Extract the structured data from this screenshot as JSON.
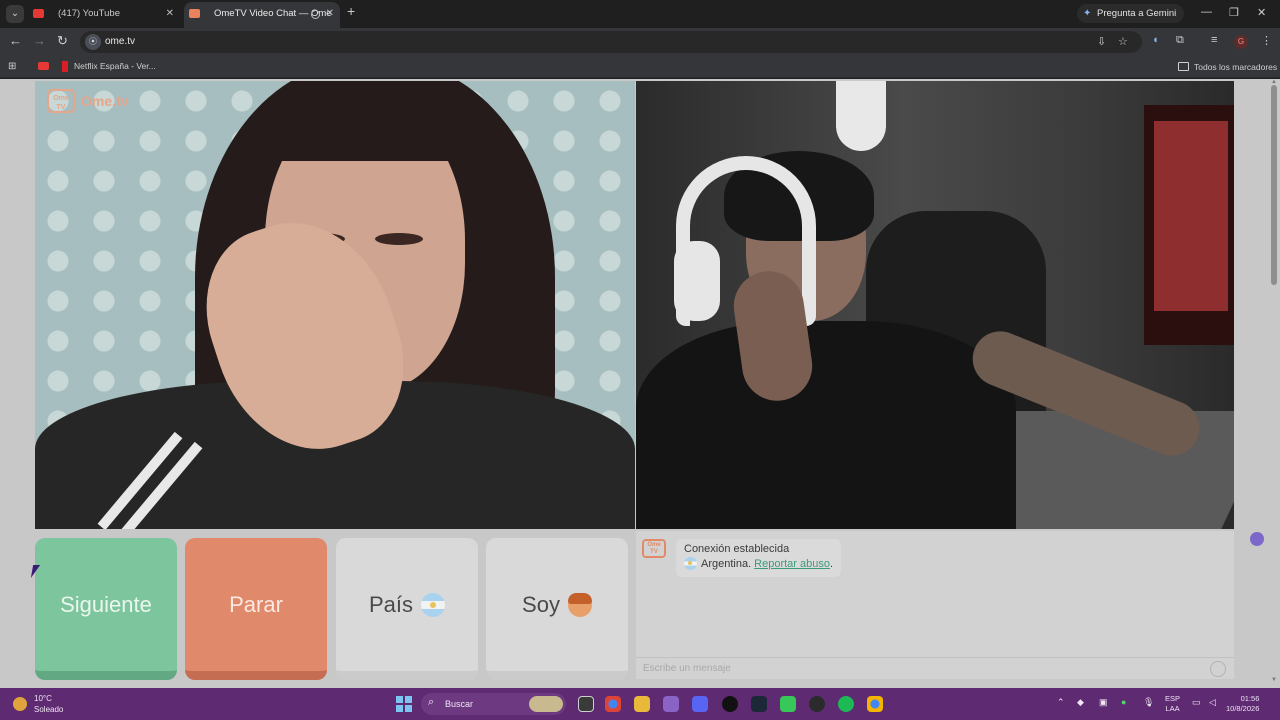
{
  "browser": {
    "tabs": [
      {
        "title": "(417) YouTube",
        "active": false
      },
      {
        "title": "OmeTV Video Chat — Ome",
        "active": true
      }
    ],
    "gemini_label": "Pregunta a Gemini",
    "url": "ome.tv",
    "bookmarks": [
      {
        "label": "Netflix España - Ver..."
      }
    ],
    "all_bookmarks_label": "Todos los marcadores",
    "profile_initial": "G"
  },
  "page": {
    "logo_text": "Ome.tv",
    "logo_box_text": "Ome TV",
    "buttons": {
      "next": "Siguiente",
      "stop": "Parar",
      "country": "País",
      "gender": "Soy"
    },
    "chat": {
      "status": "Conexión establecida",
      "country": "Argentina.",
      "report_link": "Reportar abuso",
      "report_suffix": ".",
      "input_placeholder": "Escribe un mensaje"
    },
    "colors": {
      "next_button": "#7dc59d",
      "stop_button": "#e0896b",
      "link": "#3d9b7a"
    }
  },
  "taskbar": {
    "weather": {
      "temp": "10°C",
      "condition": "Soleado"
    },
    "search_placeholder": "Buscar",
    "language": {
      "code": "ESP",
      "layout": "LAA"
    },
    "time": "01:56",
    "date": "10/8/2026"
  }
}
